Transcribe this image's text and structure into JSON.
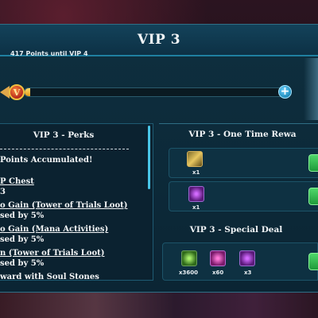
{
  "header": {
    "title": "VIP 3"
  },
  "progress": {
    "label": "417 Points until VIP 4",
    "fraction": 0.02,
    "badge_letter": "V",
    "plus_label": "+"
  },
  "perks": {
    "title": "VIP 3 - Perks",
    "lines": [
      {
        "text": "Points Accumulated!",
        "underline": false
      },
      {
        "text": "P Chest",
        "underline": true
      },
      {
        "text": "3",
        "underline": false
      },
      {
        "text": "o Gain (Tower of Trials Loot)",
        "underline": true
      },
      {
        "text": "sed by 5%",
        "underline": false
      },
      {
        "text": "o Gain (Mana Activities)",
        "underline": true
      },
      {
        "text": "sed by 5%",
        "underline": false
      },
      {
        "text": "n (Tower of Trials Loot)",
        "underline": true
      },
      {
        "text": "sed by 5%",
        "underline": false
      },
      {
        "text": "ward with Soul Stones",
        "underline": true
      }
    ]
  },
  "one_time": {
    "title": "VIP 3 - One Time Rewa",
    "rows": [
      {
        "icon": "golden-scroll-icon",
        "qty": "x1"
      },
      {
        "icon": "purple-orb-icon",
        "qty": "x1"
      }
    ]
  },
  "special_deal": {
    "title": "VIP 3 - Special Deal",
    "items": [
      {
        "icon": "green-gem-icon",
        "qty": "x3600"
      },
      {
        "icon": "pink-crystal-icon",
        "qty": "x60"
      },
      {
        "icon": "purple-orb-icon",
        "qty": "x3"
      }
    ]
  },
  "colors": {
    "panel": "#0b2534",
    "accent": "#1f7fa0",
    "gold": "#e09a1a",
    "claim": "#1f9a3a"
  }
}
